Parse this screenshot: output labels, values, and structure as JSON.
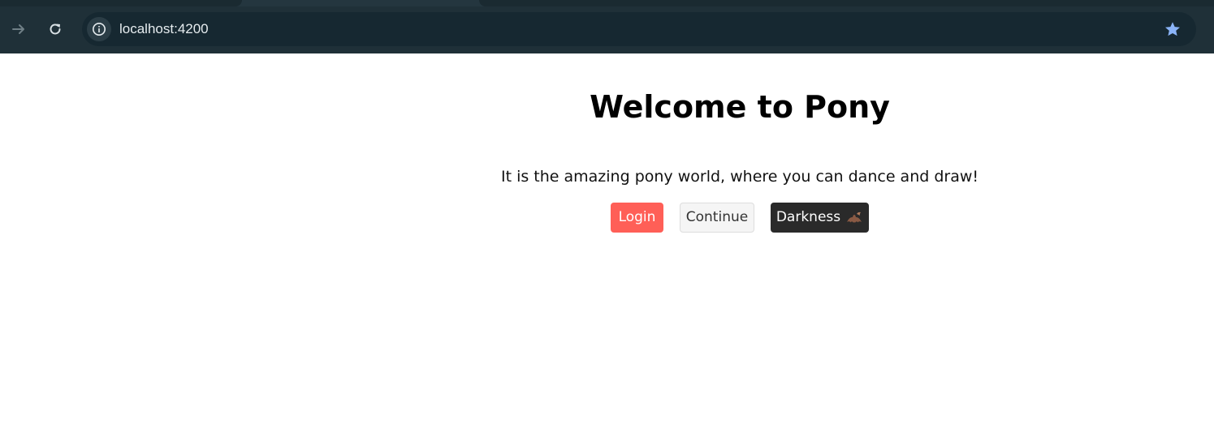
{
  "browser": {
    "url": "localhost:4200",
    "colors": {
      "chrome": "#1f3038",
      "omnibox": "#162831",
      "star": "#8ab4f8"
    },
    "icons": {
      "forward": "arrow-right-icon",
      "reload": "reload-icon",
      "site_info": "info-icon",
      "bookmark": "star-icon"
    }
  },
  "page": {
    "title": "Welcome to Pony",
    "subtitle": "It is the amazing pony world, where you can dance and draw!",
    "buttons": {
      "login": "Login",
      "continue": "Continue",
      "darkness": "Darkness",
      "darkness_icon": "bat-emoji-icon"
    },
    "colors": {
      "login_bg": "#ff5f57",
      "continue_bg": "#f5f5f5",
      "darkness_bg": "#2a2a2a"
    }
  }
}
